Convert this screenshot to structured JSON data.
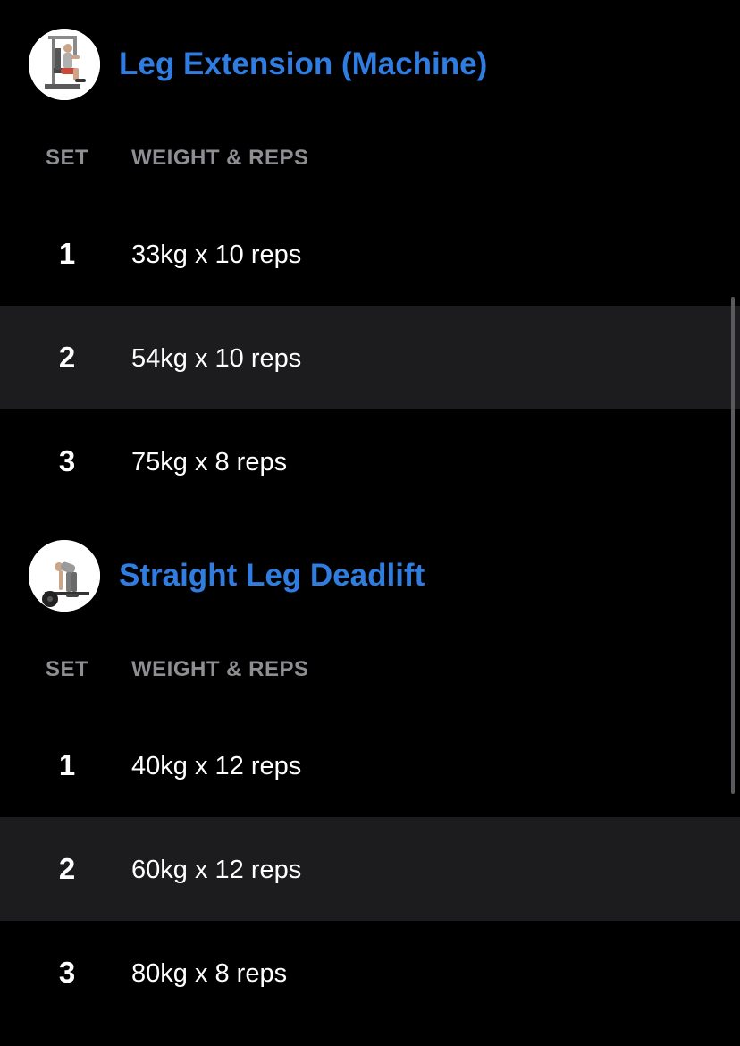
{
  "colors": {
    "background": "#000000",
    "alt_row": "#1c1c1e",
    "accent": "#2f7de1",
    "header_gray": "#8e8e93",
    "text": "#ffffff",
    "scrollbar": "#5a5a5e"
  },
  "exercises": [
    {
      "title": "Leg Extension (Machine)",
      "thumbnail_icon": "leg-extension-machine-icon",
      "columns": {
        "set": "SET",
        "weight_reps": "WEIGHT & REPS"
      },
      "sets": [
        {
          "number": "1",
          "detail": "33kg x 10 reps"
        },
        {
          "number": "2",
          "detail": "54kg x 10 reps"
        },
        {
          "number": "3",
          "detail": "75kg x 8 reps"
        }
      ]
    },
    {
      "title": "Straight Leg Deadlift",
      "thumbnail_icon": "deadlift-icon",
      "columns": {
        "set": "SET",
        "weight_reps": "WEIGHT & REPS"
      },
      "sets": [
        {
          "number": "1",
          "detail": "40kg x 12 reps"
        },
        {
          "number": "2",
          "detail": "60kg x 12 reps"
        },
        {
          "number": "3",
          "detail": "80kg x 8 reps"
        }
      ]
    }
  ]
}
